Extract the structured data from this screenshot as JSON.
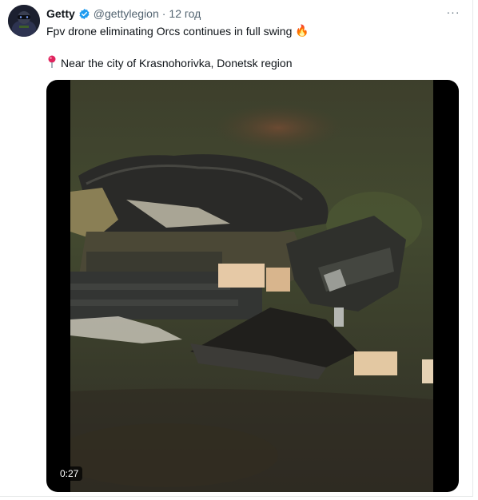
{
  "tweet": {
    "author_name": "Getty",
    "handle": "@gettylegion",
    "separator": "·",
    "time": "12 год",
    "more_label": "···",
    "text_line1": "Fpv drone eliminating Orcs continues in full swing",
    "text_line1_emoji": "🔥",
    "text_line2": "Near the city of Krasnohorivka, Donetsk region",
    "text_line2_icon": "round-pushpin-icon"
  },
  "media": {
    "type": "video",
    "duration": "0:27"
  },
  "colors": {
    "verified": "#1d9bf0",
    "text": "#0f1419",
    "secondary": "#536471",
    "pin": "#e0245e"
  }
}
